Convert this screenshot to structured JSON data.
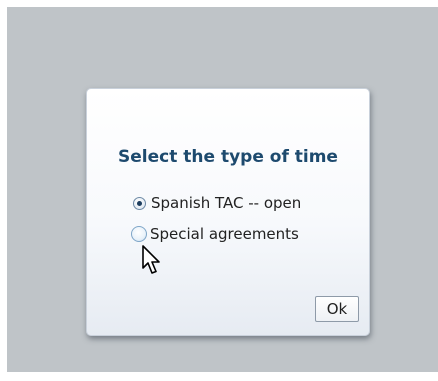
{
  "dialog": {
    "title": "Select the type of time",
    "options": [
      {
        "label": "Spanish TAC -- open",
        "selected": true
      },
      {
        "label": "Special agreements",
        "selected": false
      }
    ],
    "ok_label": "Ok"
  },
  "cursor": {
    "icon": "arrow-pointer-icon"
  },
  "colors": {
    "backdrop": "#bfc4c8",
    "title": "#1d4a6e"
  }
}
